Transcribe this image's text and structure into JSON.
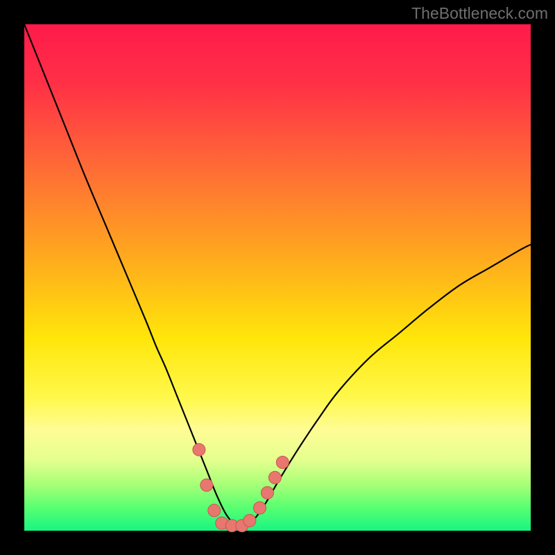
{
  "watermark": "TheBottleneck.com",
  "colors": {
    "frame": "#000000",
    "gradient_stops": [
      {
        "offset": 0,
        "color": "#ff1a4b"
      },
      {
        "offset": 0.12,
        "color": "#ff3146"
      },
      {
        "offset": 0.28,
        "color": "#ff6a36"
      },
      {
        "offset": 0.45,
        "color": "#ffa61f"
      },
      {
        "offset": 0.62,
        "color": "#ffe60a"
      },
      {
        "offset": 0.74,
        "color": "#fff94d"
      },
      {
        "offset": 0.8,
        "color": "#fffc95"
      },
      {
        "offset": 0.86,
        "color": "#e5ff8e"
      },
      {
        "offset": 0.91,
        "color": "#a6ff77"
      },
      {
        "offset": 0.955,
        "color": "#57ff71"
      },
      {
        "offset": 1.0,
        "color": "#18f582"
      }
    ],
    "curve": "#000000",
    "curve_width": 2.2,
    "marker_fill": "#e8776f",
    "marker_stroke": "#c9564e",
    "marker_radius": 9
  },
  "chart_data": {
    "type": "line",
    "title": "",
    "xlabel": "",
    "ylabel": "",
    "xlim": [
      0,
      100
    ],
    "ylim": [
      0,
      100
    ],
    "legend": false,
    "grid": false,
    "note": "Bottleneck-style V curve. x is an arbitrary hardware-balance axis (0–100), y is bottleneck percentage (0 = none, 100 = severe). Values are read off the plotted curve against the full-height axes; minimum sits near x≈40–43.",
    "series": [
      {
        "name": "bottleneck-curve",
        "x": [
          0,
          4,
          8,
          12,
          16,
          20,
          24,
          26,
          28,
          30,
          32,
          34,
          36,
          38,
          40,
          42,
          44,
          46,
          48,
          50,
          54,
          58,
          62,
          68,
          74,
          80,
          86,
          92,
          98,
          100
        ],
        "y": [
          100,
          90,
          80,
          70,
          60.5,
          51,
          41.5,
          36.5,
          32,
          27,
          22,
          17,
          12,
          7,
          3,
          1,
          1,
          3,
          6,
          9.5,
          16,
          22,
          27.5,
          34,
          39,
          44,
          48.5,
          52,
          55.5,
          56.5
        ]
      }
    ],
    "markers": {
      "name": "highlighted-points",
      "note": "Salmon dots clustered near the trough of the curve.",
      "points": [
        {
          "x": 34.5,
          "y": 16
        },
        {
          "x": 36,
          "y": 9
        },
        {
          "x": 37.5,
          "y": 4
        },
        {
          "x": 39,
          "y": 1.5
        },
        {
          "x": 41,
          "y": 1
        },
        {
          "x": 43,
          "y": 1
        },
        {
          "x": 44.5,
          "y": 2
        },
        {
          "x": 46.5,
          "y": 4.5
        },
        {
          "x": 48,
          "y": 7.5
        },
        {
          "x": 49.5,
          "y": 10.5
        },
        {
          "x": 51,
          "y": 13.5
        }
      ]
    }
  }
}
